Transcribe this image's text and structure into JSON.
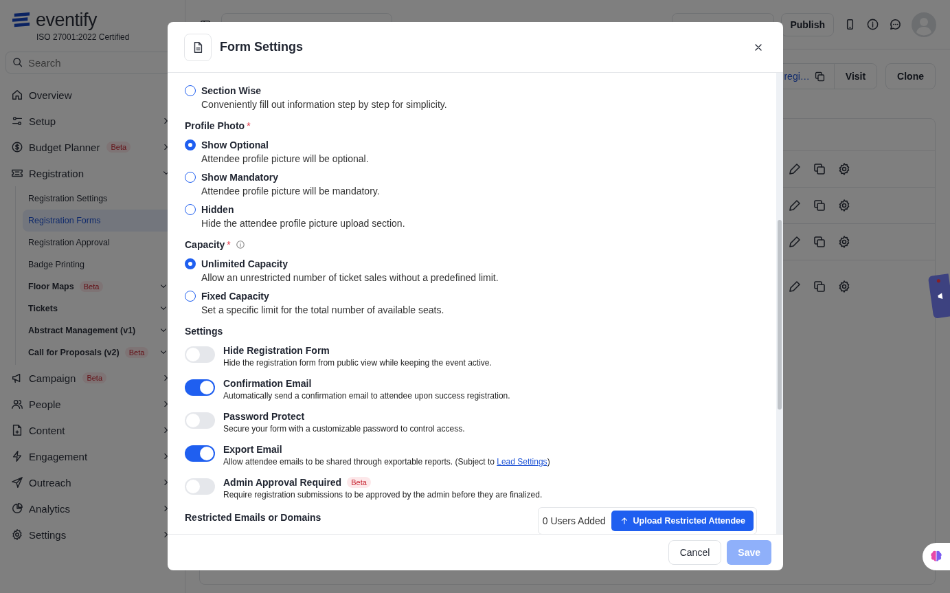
{
  "brand": {
    "name": "eventify",
    "tagline": "ISO 27001:2022 Certified"
  },
  "search": {
    "placeholder": "Search"
  },
  "nav": [
    {
      "label": "Overview",
      "expandable": false
    },
    {
      "label": "Setup",
      "expandable": true,
      "expanded": false
    },
    {
      "label": "Budget Planner",
      "badge": "Beta",
      "expandable": true,
      "expanded": false
    },
    {
      "label": "Registration",
      "expandable": true,
      "expanded": true,
      "children": [
        {
          "label": "Registration Settings",
          "selected": false,
          "bold": false,
          "expandable": false
        },
        {
          "label": "Registration Forms",
          "selected": true,
          "bold": false,
          "expandable": false
        },
        {
          "label": "Registration Approval",
          "selected": false,
          "bold": false,
          "expandable": false
        },
        {
          "label": "Badge Printing",
          "selected": false,
          "bold": false,
          "expandable": false
        },
        {
          "label": "Floor Maps",
          "badge": "Beta",
          "selected": false,
          "bold": true,
          "expandable": true
        },
        {
          "label": "Tickets",
          "selected": false,
          "bold": true,
          "expandable": true
        },
        {
          "label": "Abstract Management (v1)",
          "selected": false,
          "bold": true,
          "expandable": true
        },
        {
          "label": "Call for Proposals (v2)",
          "badge": "Beta",
          "selected": false,
          "bold": true,
          "expandable": true
        }
      ]
    },
    {
      "label": "Campaign",
      "badge": "Beta",
      "expandable": true,
      "expanded": false
    },
    {
      "label": "People",
      "expandable": true,
      "expanded": false
    },
    {
      "label": "Content",
      "expandable": true,
      "expanded": false
    },
    {
      "label": "Engagement",
      "expandable": true,
      "expanded": false
    },
    {
      "label": "Outreach",
      "expandable": true,
      "expanded": false
    },
    {
      "label": "Analytics",
      "expandable": true,
      "expanded": false
    },
    {
      "label": "Settings",
      "expandable": true,
      "expanded": false
    }
  ],
  "topbar": {
    "publish": "Publish"
  },
  "subbar": {
    "link": "regi…",
    "buttons": [
      "Visit",
      "Clone"
    ]
  },
  "modal": {
    "title": "Form Settings",
    "body": [
      {
        "kind": "radio",
        "label": "Section Wise",
        "desc": "Conveniently fill out information step by step for simplicity.",
        "selected": false
      },
      {
        "kind": "heading",
        "text": "Profile Photo",
        "mark": "*",
        "info": false
      },
      {
        "kind": "radio",
        "label": "Show Optional",
        "desc": "Attendee profile picture will be optional.",
        "selected": true
      },
      {
        "kind": "radio",
        "label": "Show Mandatory",
        "desc": "Attendee profile picture will be mandatory.",
        "selected": false
      },
      {
        "kind": "radio",
        "label": "Hidden",
        "desc": "Hide the attendee profile picture upload section.",
        "selected": false
      },
      {
        "kind": "heading",
        "text": "Capacity",
        "mark": "*",
        "info": true
      },
      {
        "kind": "radio",
        "label": "Unlimited Capacity",
        "desc": "Allow an unrestricted number of ticket sales without a predefined limit.",
        "selected": true
      },
      {
        "kind": "radio",
        "label": "Fixed Capacity",
        "desc": "Set a specific limit for the total number of available seats.",
        "selected": false
      },
      {
        "kind": "heading",
        "text": "Settings",
        "info": false
      },
      {
        "kind": "toggle",
        "label": "Hide Registration Form",
        "desc": "Hide the registration form from public view while keeping the event active.",
        "on": false
      },
      {
        "kind": "toggle",
        "label": "Confirmation Email",
        "desc": "Automatically send a confirmation email to attendee upon success registration.",
        "on": true
      },
      {
        "kind": "toggle",
        "label": "Password Protect",
        "desc": "Secure your form with a customizable password to control access.",
        "on": false
      },
      {
        "kind": "toggle",
        "label": "Export Email",
        "desc": "Allow attendee emails to be shared through exportable reports. (Subject to ",
        "link": "Lead Settings",
        "desc_end": ")",
        "on": true
      },
      {
        "kind": "toggle",
        "label": "Admin Approval Required",
        "badge": "Beta",
        "desc": "Require registration submissions to be approved by the admin before they are finalized.",
        "on": false
      },
      {
        "kind": "upload",
        "label": "Restricted Emails or Domains",
        "count": "0 Users Added",
        "button": "Upload Restricted Attendee"
      }
    ],
    "cancel": "Cancel",
    "save": {
      "label": "Save",
      "disabled": true
    }
  }
}
